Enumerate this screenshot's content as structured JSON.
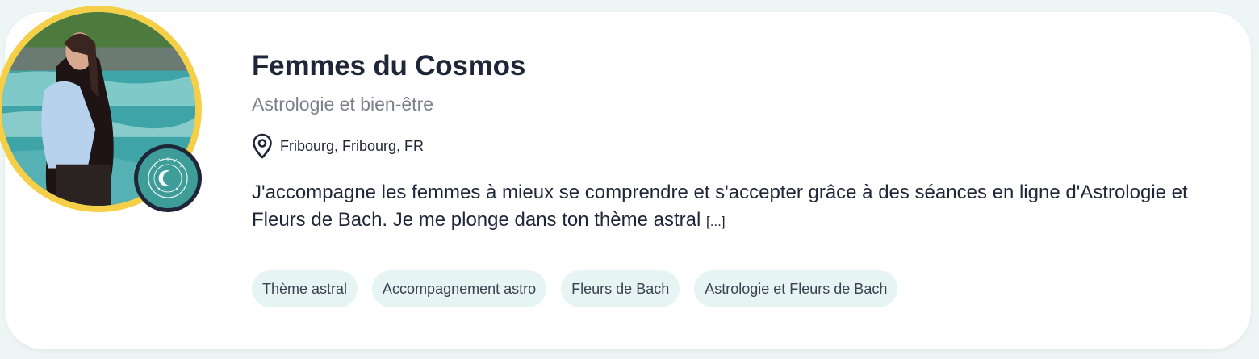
{
  "profile": {
    "name": "Femmes du Cosmos",
    "category": "Astrologie et bien-être",
    "location": "Fribourg, Fribourg, FR",
    "description": "J'accompagne les femmes à mieux se comprendre et s'accepter grâce à des séances en ligne d'Astrologie et Fleurs de Bach. Je me plonge dans ton thème astral",
    "more_label": "[...]",
    "tags": [
      "Thème astral",
      "Accompagnement astro",
      "Fleurs de Bach",
      "Astrologie et Fleurs de Bach"
    ]
  },
  "icons": {
    "location": "map-pin-icon",
    "badge": "moon-logo-icon"
  },
  "colors": {
    "avatar_ring": "#f4cf47",
    "badge_bg": "#3e9c99",
    "badge_border": "#1f2637",
    "tag_bg": "#e7f4f4",
    "title": "#1f2638",
    "subtitle": "#7a7f8b"
  }
}
